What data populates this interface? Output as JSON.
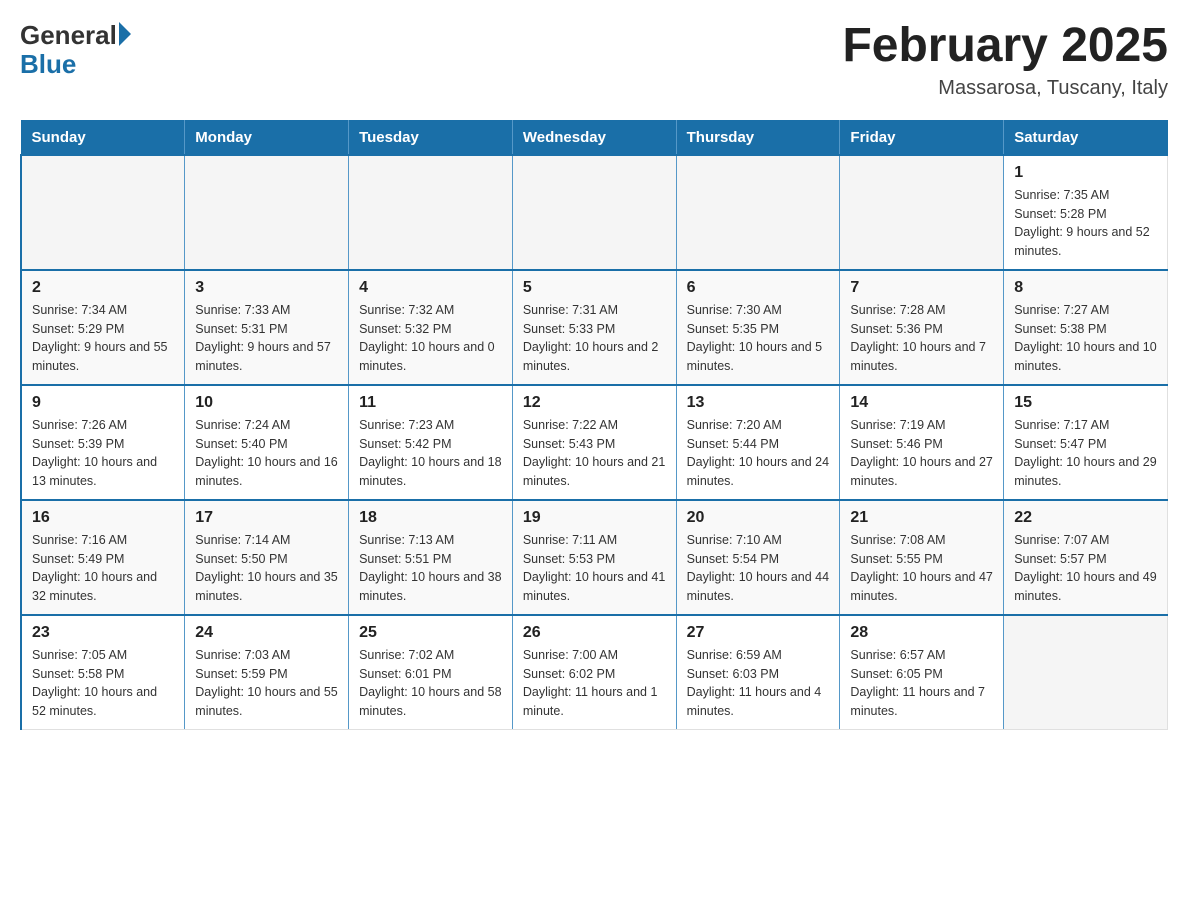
{
  "header": {
    "title": "February 2025",
    "subtitle": "Massarosa, Tuscany, Italy"
  },
  "logo": {
    "general": "General",
    "blue": "Blue"
  },
  "days_of_week": [
    "Sunday",
    "Monday",
    "Tuesday",
    "Wednesday",
    "Thursday",
    "Friday",
    "Saturday"
  ],
  "weeks": [
    [
      {
        "day": "",
        "info": ""
      },
      {
        "day": "",
        "info": ""
      },
      {
        "day": "",
        "info": ""
      },
      {
        "day": "",
        "info": ""
      },
      {
        "day": "",
        "info": ""
      },
      {
        "day": "",
        "info": ""
      },
      {
        "day": "1",
        "info": "Sunrise: 7:35 AM\nSunset: 5:28 PM\nDaylight: 9 hours and 52 minutes."
      }
    ],
    [
      {
        "day": "2",
        "info": "Sunrise: 7:34 AM\nSunset: 5:29 PM\nDaylight: 9 hours and 55 minutes."
      },
      {
        "day": "3",
        "info": "Sunrise: 7:33 AM\nSunset: 5:31 PM\nDaylight: 9 hours and 57 minutes."
      },
      {
        "day": "4",
        "info": "Sunrise: 7:32 AM\nSunset: 5:32 PM\nDaylight: 10 hours and 0 minutes."
      },
      {
        "day": "5",
        "info": "Sunrise: 7:31 AM\nSunset: 5:33 PM\nDaylight: 10 hours and 2 minutes."
      },
      {
        "day": "6",
        "info": "Sunrise: 7:30 AM\nSunset: 5:35 PM\nDaylight: 10 hours and 5 minutes."
      },
      {
        "day": "7",
        "info": "Sunrise: 7:28 AM\nSunset: 5:36 PM\nDaylight: 10 hours and 7 minutes."
      },
      {
        "day": "8",
        "info": "Sunrise: 7:27 AM\nSunset: 5:38 PM\nDaylight: 10 hours and 10 minutes."
      }
    ],
    [
      {
        "day": "9",
        "info": "Sunrise: 7:26 AM\nSunset: 5:39 PM\nDaylight: 10 hours and 13 minutes."
      },
      {
        "day": "10",
        "info": "Sunrise: 7:24 AM\nSunset: 5:40 PM\nDaylight: 10 hours and 16 minutes."
      },
      {
        "day": "11",
        "info": "Sunrise: 7:23 AM\nSunset: 5:42 PM\nDaylight: 10 hours and 18 minutes."
      },
      {
        "day": "12",
        "info": "Sunrise: 7:22 AM\nSunset: 5:43 PM\nDaylight: 10 hours and 21 minutes."
      },
      {
        "day": "13",
        "info": "Sunrise: 7:20 AM\nSunset: 5:44 PM\nDaylight: 10 hours and 24 minutes."
      },
      {
        "day": "14",
        "info": "Sunrise: 7:19 AM\nSunset: 5:46 PM\nDaylight: 10 hours and 27 minutes."
      },
      {
        "day": "15",
        "info": "Sunrise: 7:17 AM\nSunset: 5:47 PM\nDaylight: 10 hours and 29 minutes."
      }
    ],
    [
      {
        "day": "16",
        "info": "Sunrise: 7:16 AM\nSunset: 5:49 PM\nDaylight: 10 hours and 32 minutes."
      },
      {
        "day": "17",
        "info": "Sunrise: 7:14 AM\nSunset: 5:50 PM\nDaylight: 10 hours and 35 minutes."
      },
      {
        "day": "18",
        "info": "Sunrise: 7:13 AM\nSunset: 5:51 PM\nDaylight: 10 hours and 38 minutes."
      },
      {
        "day": "19",
        "info": "Sunrise: 7:11 AM\nSunset: 5:53 PM\nDaylight: 10 hours and 41 minutes."
      },
      {
        "day": "20",
        "info": "Sunrise: 7:10 AM\nSunset: 5:54 PM\nDaylight: 10 hours and 44 minutes."
      },
      {
        "day": "21",
        "info": "Sunrise: 7:08 AM\nSunset: 5:55 PM\nDaylight: 10 hours and 47 minutes."
      },
      {
        "day": "22",
        "info": "Sunrise: 7:07 AM\nSunset: 5:57 PM\nDaylight: 10 hours and 49 minutes."
      }
    ],
    [
      {
        "day": "23",
        "info": "Sunrise: 7:05 AM\nSunset: 5:58 PM\nDaylight: 10 hours and 52 minutes."
      },
      {
        "day": "24",
        "info": "Sunrise: 7:03 AM\nSunset: 5:59 PM\nDaylight: 10 hours and 55 minutes."
      },
      {
        "day": "25",
        "info": "Sunrise: 7:02 AM\nSunset: 6:01 PM\nDaylight: 10 hours and 58 minutes."
      },
      {
        "day": "26",
        "info": "Sunrise: 7:00 AM\nSunset: 6:02 PM\nDaylight: 11 hours and 1 minute."
      },
      {
        "day": "27",
        "info": "Sunrise: 6:59 AM\nSunset: 6:03 PM\nDaylight: 11 hours and 4 minutes."
      },
      {
        "day": "28",
        "info": "Sunrise: 6:57 AM\nSunset: 6:05 PM\nDaylight: 11 hours and 7 minutes."
      },
      {
        "day": "",
        "info": ""
      }
    ]
  ]
}
